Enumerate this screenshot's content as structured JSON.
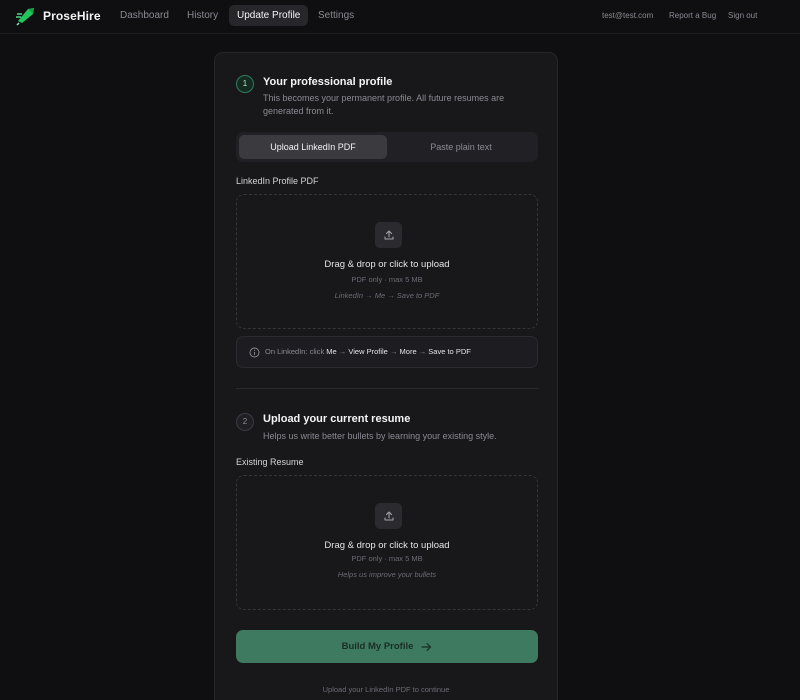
{
  "nav": {
    "brand": "ProseHire",
    "links": [
      "Dashboard",
      "History",
      "Update Profile",
      "Settings"
    ],
    "active_link": "Update Profile",
    "email": "test@test.com",
    "report_bug": "Report a Bug",
    "sign_out": "Sign out"
  },
  "colors": {
    "accent": "#3d7a5f",
    "background": "#0f0f11",
    "card": "#18181b"
  },
  "step1": {
    "number": "1",
    "title": "Your professional profile",
    "desc_line1": "This becomes your permanent profile. All future resumes are",
    "desc_line2": "generated from it.",
    "tabs": [
      "Upload LinkedIn PDF",
      "Paste plain text"
    ],
    "active_tab": "Upload LinkedIn PDF",
    "field_label": "LinkedIn Profile PDF",
    "dropzone": {
      "icon": "upload-icon",
      "title": "Drag & drop or click to upload",
      "sub": "PDF only · max 5 MB",
      "hint": "LinkedIn → Me → Save to PDF"
    },
    "info": {
      "icon": "info-icon",
      "prefix": "On LinkedIn: click",
      "me": "Me",
      "view_profile": "View Profile",
      "more": "More",
      "save_pdf": "Save to PDF"
    }
  },
  "step2": {
    "number": "2",
    "title": "Upload your current resume",
    "desc": "Helps us write better bullets by learning your existing style.",
    "field_label": "Existing Resume",
    "dropzone": {
      "icon": "upload-icon",
      "title": "Drag & drop or click to upload",
      "sub": "PDF only · max 5 MB",
      "hint": "Helps us improve your bullets"
    }
  },
  "build_button": "Build My Profile",
  "footnote": "Upload your LinkedIn PDF to continue"
}
